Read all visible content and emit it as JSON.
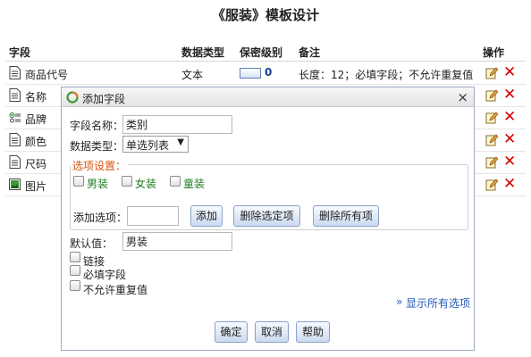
{
  "page_title": "《服装》模板设计",
  "headers": {
    "field": "字段",
    "type": "数据类型",
    "rank": "保密级别",
    "note": "备注",
    "ops": "操作"
  },
  "rows": [
    {
      "name": "商品代号",
      "type": "文本",
      "rank": "0",
      "note": "长度：12；必填字段；不允许重复值",
      "icon": "document-icon"
    },
    {
      "name": "名称",
      "icon": "document-icon"
    },
    {
      "name": "品牌",
      "icon": "list-icon"
    },
    {
      "name": "颜色",
      "icon": "document-icon"
    },
    {
      "name": "尺码",
      "icon": "document-icon"
    },
    {
      "name": "图片",
      "icon": "image-icon"
    }
  ],
  "dialog": {
    "title": "添加字段",
    "close": "×",
    "field_name_label": "字段名称：",
    "field_name_value": "类别",
    "data_type_label": "数据类型：",
    "data_type_value": "单选列表",
    "option_settings_label": "选项设置：",
    "options": [
      "男装",
      "女装",
      "童装"
    ],
    "add_option_label": "添加选项：",
    "add_option_value": "",
    "add_button": "添加",
    "delete_selected_button": "删除选定项",
    "delete_all_button": "删除所有项",
    "default_label": "默认值：",
    "default_value": "男装",
    "link_checkbox": "链接",
    "required_checkbox": "必填字段",
    "unique_checkbox": "不允许重复值",
    "show_all_options": "显示所有选项",
    "confirm_button": "确定",
    "cancel_button": "取消",
    "help_button": "帮助"
  },
  "colors": {
    "accent": "#2457b8",
    "legend": "#d9530f",
    "option_text": "#1e7d1e",
    "delete": "#d40000"
  }
}
